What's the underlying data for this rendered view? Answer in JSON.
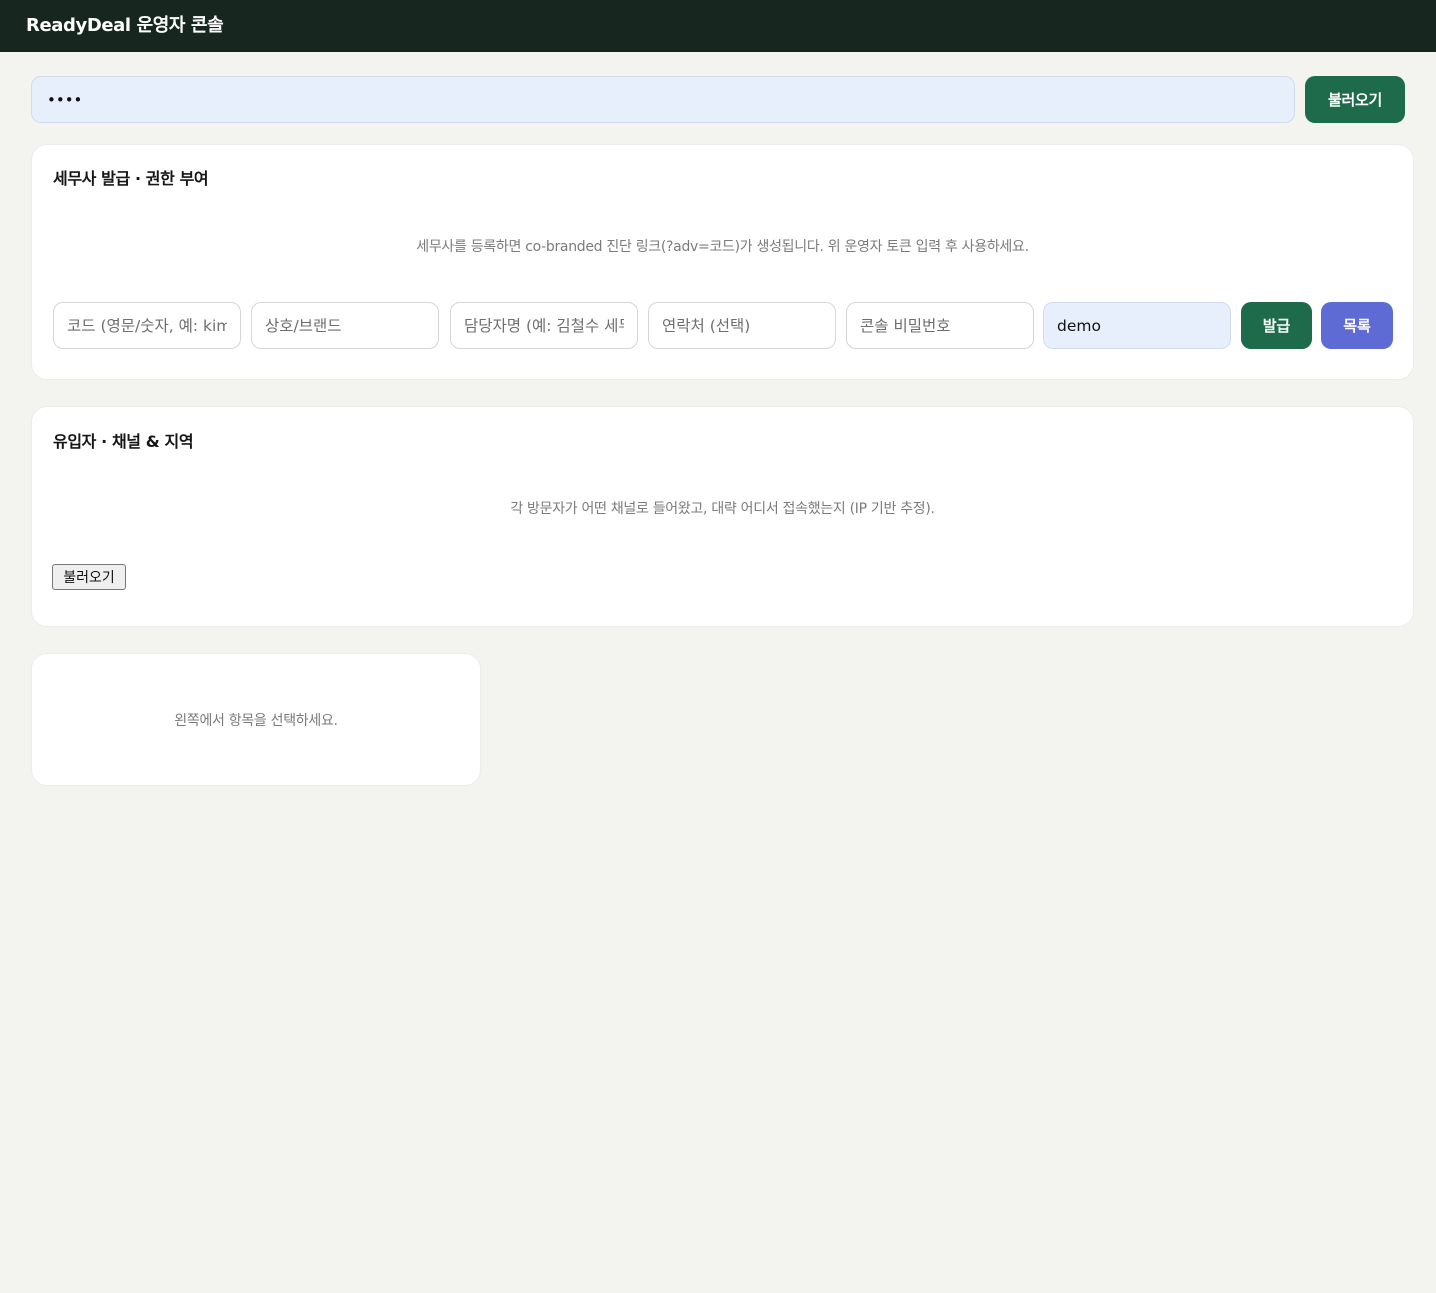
{
  "header": {
    "title": "ReadyDeal 운영자 콘솔"
  },
  "token": {
    "value": "••••",
    "load_label": "불러오기"
  },
  "advisor": {
    "title": "세무사 발급 · 권한 부여",
    "hint": "세무사를 등록하면 co-branded 진단 링크(?adv=코드)가 생성됩니다. 위 운영자 토큰 입력 후 사용하세요.",
    "fields": {
      "code_placeholder": "코드 (영문/숫자, 예: kim",
      "brand_placeholder": "상호/브랜드",
      "manager_placeholder": "담당자명 (예: 김철수 세무",
      "contact_placeholder": "연락처 (선택)",
      "password_placeholder": "콘솔 비밀번호",
      "extra_value": "demo"
    },
    "issue_label": "발급",
    "list_label": "목록"
  },
  "traffic": {
    "title": "유입자 · 채널 & 지역",
    "hint": "각 방문자가 어떤 채널로 들어왔고, 대략 어디서 접속했는지 (IP 기반 추정).",
    "load_label": "불러오기"
  },
  "detail": {
    "empty_text": "왼쪽에서 항목을 선택하세요."
  }
}
